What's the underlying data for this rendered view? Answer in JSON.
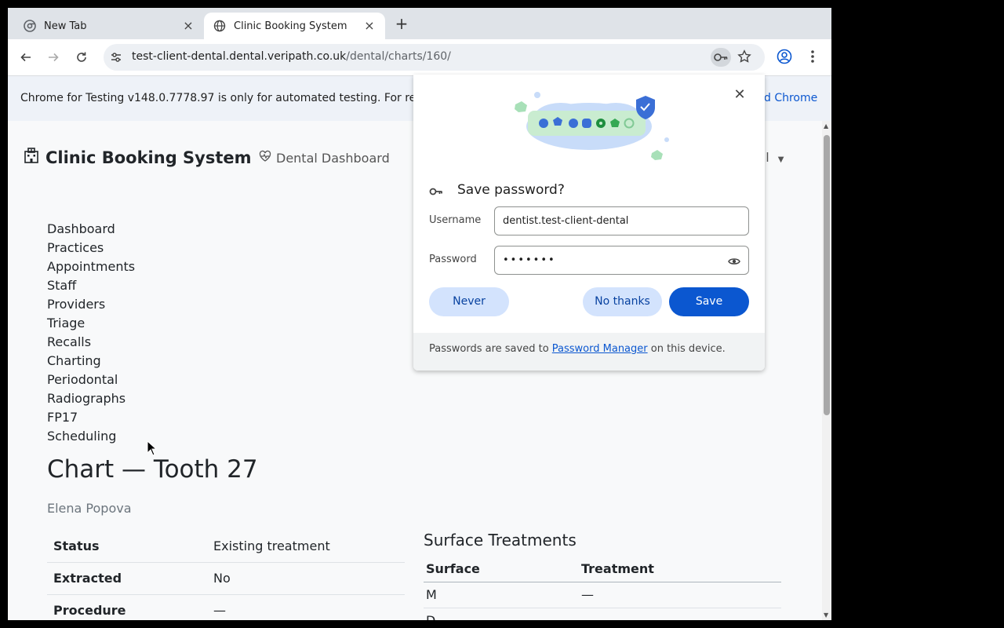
{
  "browser": {
    "tabs": [
      {
        "title": "New Tab",
        "icon": "chrome-icon"
      },
      {
        "title": "Clinic Booking System",
        "icon": "globe-icon"
      }
    ],
    "url_host": "test-client-dental.dental.veripath.co.uk",
    "url_path": "/dental/charts/160/",
    "infobar_text": "Chrome for Testing v148.0.7778.97 is only for automated testing. For re",
    "infobar_link": "d Chrome"
  },
  "header": {
    "brand": "Clinic Booking System",
    "dashboard_link": "Dental Dashboard",
    "user_menu": "ntal"
  },
  "nav": {
    "items": [
      "Dashboard",
      "Practices",
      "Appointments",
      "Staff",
      "Providers",
      "Triage",
      "Recalls",
      "Charting",
      "Periodontal",
      "Radiographs",
      "FP17",
      "Scheduling"
    ]
  },
  "chart": {
    "title": "Chart — Tooth 27",
    "patient": "Elena Popova",
    "details": [
      {
        "label": "Status",
        "value": "Existing treatment"
      },
      {
        "label": "Extracted",
        "value": "No"
      },
      {
        "label": "Procedure",
        "value": "—"
      }
    ],
    "surface_heading": "Surface Treatments",
    "surface_columns": [
      "Surface",
      "Treatment"
    ],
    "surfaces": [
      {
        "surface": "M",
        "treatment": "—"
      },
      {
        "surface": "D",
        "treatment": "—"
      }
    ]
  },
  "password_dialog": {
    "title": "Save password?",
    "username_label": "Username",
    "username_value": "dentist.test-client-dental",
    "password_label": "Password",
    "password_value": "•••••••",
    "never_label": "Never",
    "no_thanks_label": "No thanks",
    "save_label": "Save",
    "footer_before": "Passwords are saved to ",
    "footer_link": "Password Manager",
    "footer_after": " on this device."
  },
  "colors": {
    "accent": "#0b57d0",
    "tonal": "#d3e3fd"
  }
}
